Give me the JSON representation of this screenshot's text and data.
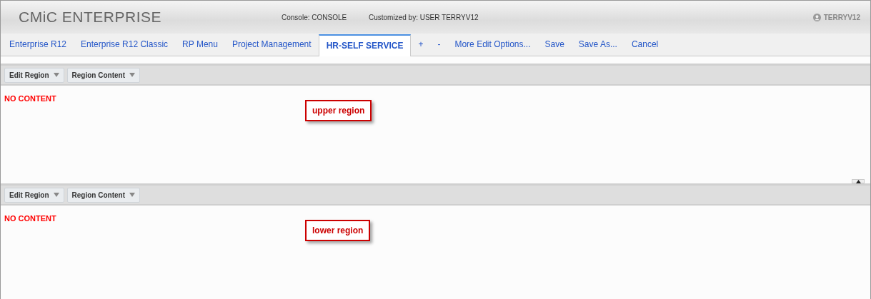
{
  "header": {
    "logo": "CMiC ENTERPRISE",
    "console": "Console: CONSOLE",
    "customized_by": "Customized by: USER TERRYV12",
    "user": "TERRYV12"
  },
  "tabs": [
    {
      "label": "Enterprise R12",
      "selected": false
    },
    {
      "label": "Enterprise R12 Classic",
      "selected": false
    },
    {
      "label": "RP Menu",
      "selected": false
    },
    {
      "label": "Project Management",
      "selected": false
    },
    {
      "label": "HR-SELF SERVICE",
      "selected": true
    }
  ],
  "actions": [
    "+",
    "-",
    "More Edit Options...",
    "Save",
    "Save As...",
    "Cancel"
  ],
  "regions": [
    {
      "menus": [
        "Edit Region",
        "Region Content"
      ],
      "message": "NO CONTENT",
      "callout": "upper region"
    },
    {
      "menus": [
        "Edit Region",
        "Region Content"
      ],
      "message": "NO CONTENT",
      "callout": "lower region"
    }
  ]
}
